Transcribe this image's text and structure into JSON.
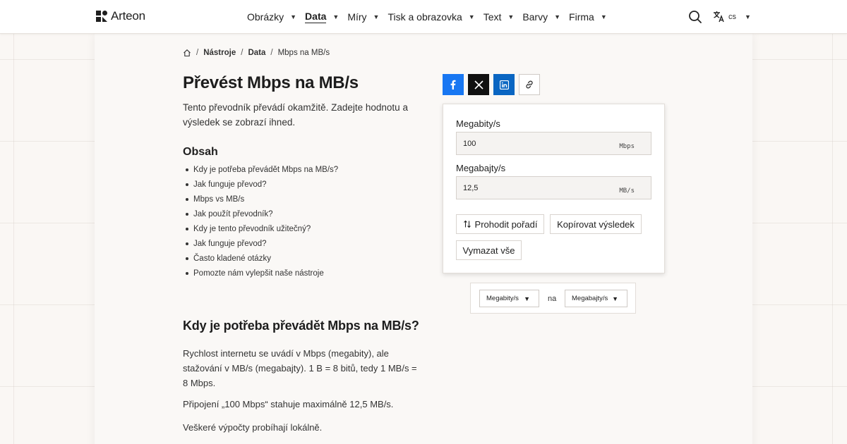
{
  "brand": {
    "name": "Arteon"
  },
  "nav": {
    "items": [
      {
        "label": "Obrázky",
        "active": false
      },
      {
        "label": "Data",
        "active": true
      },
      {
        "label": "Míry",
        "active": false
      },
      {
        "label": "Tisk a obrazovka",
        "active": false
      },
      {
        "label": "Text",
        "active": false
      },
      {
        "label": "Barvy",
        "active": false
      },
      {
        "label": "Firma",
        "active": false
      }
    ],
    "search_icon": "search-icon",
    "language": {
      "code": "cs",
      "icon": "translate-icon"
    }
  },
  "breadcrumb": {
    "items": [
      "Nástroje",
      "Data",
      "Mbps na MB/s"
    ],
    "home_icon": "home-icon"
  },
  "page": {
    "title": "Převést Mbps na MB/s",
    "intro": "Tento převodník převádí okamžitě. Zadejte hodnotu a výsledek se zobrazí ihned.",
    "toc_title": "Obsah",
    "toc": [
      "Kdy je potřeba převádět Mbps na MB/s?",
      "Jak funguje převod?",
      "Mbps vs MB/s",
      "Jak použít převodník?",
      "Kdy je tento převodník užitečný?",
      "Jak funguje převod?",
      "Často kladené otázky",
      "Pomozte nám vylepšit naše nástroje"
    ],
    "section_heading": "Kdy je potřeba převádět Mbps na MB/s?",
    "section_paragraphs": [
      "Rychlost internetu se uvádí v Mbps (megabity), ale stažování v MB/s (megabajty). 1 B = 8 bitů, tedy 1 MB/s = 8 Mbps.",
      "Připojení „100 Mbps“ stahuje maximálně 12,5 MB/s.",
      "Veškeré výpočty probíhají lokálně."
    ]
  },
  "share": {
    "icons": [
      "facebook-icon",
      "x-icon",
      "linkedin-icon",
      "link-icon"
    ]
  },
  "converter": {
    "from": {
      "label": "Megabity/s",
      "value": "100",
      "unit": "Mbps"
    },
    "to": {
      "label": "Megabajty/s",
      "value": "12,5",
      "unit": "MB/s"
    },
    "swap_label": "Prohodit pořadí",
    "copy_label": "Kopírovat výsledek",
    "clear_label": "Vymazat vše"
  },
  "unit_bar": {
    "from_unit": "Megabity/s",
    "joiner": "na",
    "to_unit": "Megabajty/s"
  },
  "colors": {
    "facebook": "#1877f2",
    "x": "#111111",
    "linkedin": "#0a66c2",
    "background": "#faf7f4"
  }
}
